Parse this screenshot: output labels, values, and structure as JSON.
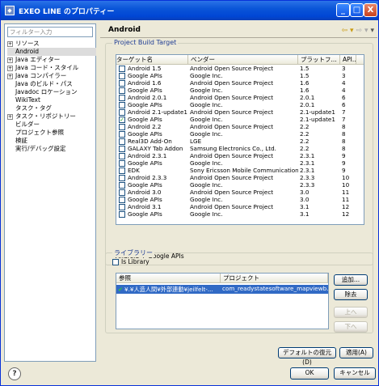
{
  "window": {
    "title": "EXEO LINE のプロパティー",
    "minimize": "_",
    "maximize": "□",
    "close": "X"
  },
  "left": {
    "filter_placeholder": "フィルター入力",
    "tree": [
      {
        "label": "リソース",
        "expandable": true
      },
      {
        "label": "Android",
        "expandable": false,
        "selected": true
      },
      {
        "label": "Java エディター",
        "expandable": true
      },
      {
        "label": "Java コード・スタイル",
        "expandable": true
      },
      {
        "label": "Java コンパイラー",
        "expandable": true
      },
      {
        "label": "Java のビルド・パス",
        "expandable": false
      },
      {
        "label": "Javadoc ロケーション",
        "expandable": false
      },
      {
        "label": "WikiText",
        "expandable": false
      },
      {
        "label": "タスク・タグ",
        "expandable": false
      },
      {
        "label": "タスク・リポジトリー",
        "expandable": true
      },
      {
        "label": "ビルダー",
        "expandable": false
      },
      {
        "label": "プロジェクト参照",
        "expandable": false
      },
      {
        "label": "検証",
        "expandable": false
      },
      {
        "label": "実行/デバッグ設定",
        "expandable": false
      }
    ]
  },
  "page": {
    "title": "Android"
  },
  "build_target": {
    "group_label": "Project Build Target",
    "columns": [
      "ターゲット名",
      "ベンダー",
      "プラットフ...",
      "API..."
    ],
    "rows": [
      {
        "name": "Android 1.5",
        "vendor": "Android Open Source Project",
        "platform": "1.5",
        "api": "3",
        "checked": false
      },
      {
        "name": "Google APIs",
        "vendor": "Google Inc.",
        "platform": "1.5",
        "api": "3",
        "checked": false
      },
      {
        "name": "Android 1.6",
        "vendor": "Android Open Source Project",
        "platform": "1.6",
        "api": "4",
        "checked": false
      },
      {
        "name": "Google APIs",
        "vendor": "Google Inc.",
        "platform": "1.6",
        "api": "4",
        "checked": false
      },
      {
        "name": "Android 2.0.1",
        "vendor": "Android Open Source Project",
        "platform": "2.0.1",
        "api": "6",
        "checked": false
      },
      {
        "name": "Google APIs",
        "vendor": "Google Inc.",
        "platform": "2.0.1",
        "api": "6",
        "checked": false
      },
      {
        "name": "Android 2.1-update1",
        "vendor": "Android Open Source Project",
        "platform": "2.1-update1",
        "api": "7",
        "checked": false
      },
      {
        "name": "Google APIs",
        "vendor": "Google Inc.",
        "platform": "2.1-update1",
        "api": "7",
        "checked": true
      },
      {
        "name": "Android 2.2",
        "vendor": "Android Open Source Project",
        "platform": "2.2",
        "api": "8",
        "checked": false
      },
      {
        "name": "Google APIs",
        "vendor": "Google Inc.",
        "platform": "2.2",
        "api": "8",
        "checked": false
      },
      {
        "name": "Real3D Add-On",
        "vendor": "LGE",
        "platform": "2.2",
        "api": "8",
        "checked": false
      },
      {
        "name": "GALAXY Tab Addon",
        "vendor": "Samsung Electronics Co., Ltd.",
        "platform": "2.2",
        "api": "8",
        "checked": false
      },
      {
        "name": "Android 2.3.1",
        "vendor": "Android Open Source Project",
        "platform": "2.3.1",
        "api": "9",
        "checked": false
      },
      {
        "name": "Google APIs",
        "vendor": "Google Inc.",
        "platform": "2.3.1",
        "api": "9",
        "checked": false
      },
      {
        "name": "EDK",
        "vendor": "Sony Ericsson Mobile Communication...",
        "platform": "2.3.1",
        "api": "9",
        "checked": false
      },
      {
        "name": "Android 2.3.3",
        "vendor": "Android Open Source Project",
        "platform": "2.3.3",
        "api": "10",
        "checked": false
      },
      {
        "name": "Google APIs",
        "vendor": "Google Inc.",
        "platform": "2.3.3",
        "api": "10",
        "checked": false
      },
      {
        "name": "Android 3.0",
        "vendor": "Android Open Source Project",
        "platform": "3.0",
        "api": "11",
        "checked": false
      },
      {
        "name": "Google APIs",
        "vendor": "Google Inc.",
        "platform": "3.0",
        "api": "11",
        "checked": false
      },
      {
        "name": "Android 3.1",
        "vendor": "Android Open Source Project",
        "platform": "3.1",
        "api": "12",
        "checked": false
      },
      {
        "name": "Google APIs",
        "vendor": "Google Inc.",
        "platform": "3.1",
        "api": "12",
        "checked": false
      }
    ],
    "description": "Android + Google APIs"
  },
  "library": {
    "group_label": "ライブラリー",
    "is_library_label": "Is Library",
    "columns": [
      "参照",
      "プロジェクト"
    ],
    "rows": [
      {
        "reference": "¥.¥人造人間¥外部連動¥jeilfelt-...",
        "project": "com_readystatesoftware_mapviewb..."
      }
    ],
    "buttons": {
      "add": "追加...",
      "remove": "除去",
      "up": "上へ",
      "down": "下へ"
    }
  },
  "footer": {
    "restore_defaults": "デフォルトの復元(D)",
    "apply": "適用(A)",
    "ok": "OK",
    "cancel": "キャンセル",
    "help": "?"
  },
  "nav": {
    "back": "⇦ ▾",
    "forward": "⇨ ▾",
    "menu": "▾"
  }
}
